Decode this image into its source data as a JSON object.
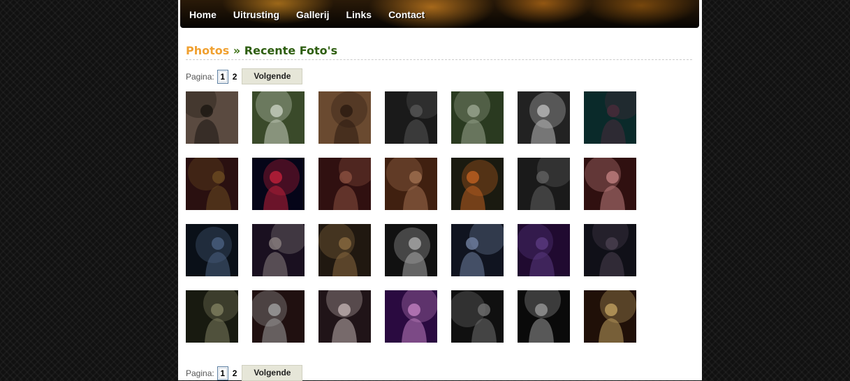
{
  "nav": [
    "Home",
    "Uitrusting",
    "Gallerij",
    "Links",
    "Contact"
  ],
  "heading": {
    "section": "Photos",
    "sep": "»",
    "title": "Recente Foto's"
  },
  "pager": {
    "label": "Pagina:",
    "current": "1",
    "other": "2",
    "next": "Volgende"
  },
  "thumbs": [
    [
      "#5a4a40",
      "#1c1612",
      "person-fur"
    ],
    [
      "#3a4a2a",
      "#c8d0c0",
      "person-black-top"
    ],
    [
      "#6a4a30",
      "#2a1a10",
      "person-hair"
    ],
    [
      "#1a1a1a",
      "#555",
      "person-lying"
    ],
    [
      "#2a3a20",
      "#9aa590",
      "person-black-top"
    ],
    [
      "#222",
      "#bbb",
      "person-portrait"
    ],
    [
      "#0a2a2a",
      "#4a2a3a",
      "dj-decks"
    ],
    [
      "#2a1010",
      "#6a4a20",
      "couple"
    ],
    [
      "#050518",
      "#c0203a",
      "stage-red"
    ],
    [
      "#301010",
      "#8a5040",
      "hands-crowd"
    ],
    [
      "#402010",
      "#a07050",
      "group"
    ],
    [
      "#1a1a10",
      "#c06020",
      "group-sashes"
    ],
    [
      "#1a1a1a",
      "#606060",
      "dj-tshirt"
    ],
    [
      "#301010",
      "#c08080",
      "crowd-lights"
    ],
    [
      "#0a1018",
      "#4a6080",
      "dj-plaid"
    ],
    [
      "#1a1020",
      "#8a8080",
      "dj-arms-up"
    ],
    [
      "#201810",
      "#8a6a40",
      "dj-pair"
    ],
    [
      "#111",
      "#aaa",
      "dj-bw"
    ],
    [
      "#101420",
      "#7080a0",
      "dj-stage-blue"
    ],
    [
      "#200a30",
      "#5a3a80",
      "dj-purple"
    ],
    [
      "#101018",
      "#4a4050",
      "dj-bald"
    ],
    [
      "#181a10",
      "#808060",
      "dj-beams"
    ],
    [
      "#201010",
      "#a0a0a0",
      "dj-white-shirt"
    ],
    [
      "#201418",
      "#c0b0b0",
      "dj-white-top"
    ],
    [
      "#2a0a40",
      "#c080c0",
      "dj-record"
    ],
    [
      "#101010",
      "#707070",
      "dj-gray"
    ],
    [
      "#0a0a0a",
      "#999",
      "dj-headphones"
    ],
    [
      "#201008",
      "#c0a060",
      "dj-vinyl"
    ]
  ]
}
